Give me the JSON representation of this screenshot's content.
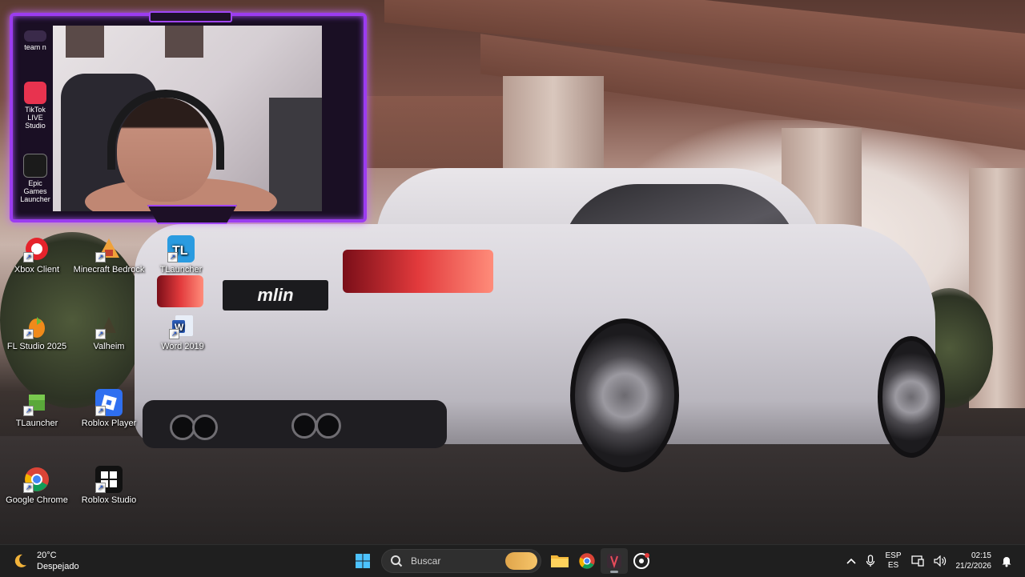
{
  "webcam": {
    "side_items": [
      {
        "label": "team n",
        "icon": "team-icon"
      },
      {
        "label": "TikTok LIVE Studio",
        "icon": "tiktok-live-icon"
      },
      {
        "label": "Epic Games Launcher",
        "icon": "epic-games-icon"
      }
    ]
  },
  "car": {
    "plate": "mlin"
  },
  "desktop_icons": [
    {
      "label": "Xbox Client",
      "icon": "xbox-client-icon"
    },
    {
      "label": "Minecraft Bedrock",
      "icon": "minecraft-bedrock-icon"
    },
    {
      "label": "TLauncher",
      "icon": "tlauncher-icon"
    },
    {
      "label": "FL Studio 2025",
      "icon": "fl-studio-icon"
    },
    {
      "label": "Valheim",
      "icon": "valheim-icon"
    },
    {
      "label": "Word 2019",
      "icon": "word-icon"
    },
    {
      "label": "TLauncher",
      "icon": "tlauncher-icon"
    },
    {
      "label": "Roblox Player",
      "icon": "roblox-player-icon"
    },
    {
      "label": "Google Chrome",
      "icon": "chrome-icon"
    },
    {
      "label": "Roblox Studio",
      "icon": "roblox-studio-icon"
    }
  ],
  "taskbar": {
    "weather": {
      "temperature": "20°C",
      "condition": "Despejado",
      "icon": "moon-icon"
    },
    "search_placeholder": "Buscar",
    "apps": [
      {
        "name": "Start",
        "icon": "windows-start-icon"
      },
      {
        "name": "File Explorer",
        "icon": "folder-icon"
      },
      {
        "name": "Google Chrome",
        "icon": "chrome-icon"
      },
      {
        "name": "OBS-like streaming app",
        "icon": "stream-app-icon",
        "active": true
      },
      {
        "name": "Steam/ game app",
        "icon": "app-icon"
      }
    ],
    "tray": {
      "language": "ESP",
      "layout": "ES",
      "time": "02:15",
      "date": "21/2/2026"
    }
  },
  "colors": {
    "overlay_accent": "#9b3cf0",
    "taskbar_bg": "#1f1f1f"
  }
}
